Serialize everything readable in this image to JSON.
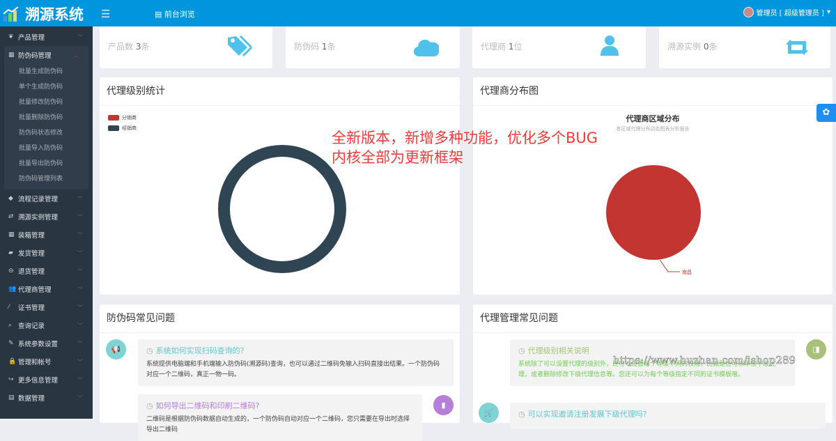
{
  "header": {
    "title": "溯源系统",
    "front_label": "前台浏览",
    "user": "管理员 [ 超级管理员 ]"
  },
  "sidebar": {
    "items": [
      {
        "label": "产品管理",
        "icon": "leaf-icon"
      },
      {
        "label": "防伪码管理",
        "icon": "qrcode-icon",
        "open": true,
        "children": [
          "批量生成防伪码",
          "单个生成防伪码",
          "批量修改防伪码",
          "批量删除防伪码",
          "防伪码状态修改",
          "批量导入防伪码",
          "批量导出防伪码",
          "防伪码管理列表"
        ]
      },
      {
        "label": "流程记录管理",
        "icon": "tags-icon"
      },
      {
        "label": "溯源实例管理",
        "icon": "retweet-icon"
      },
      {
        "label": "装箱管理",
        "icon": "grid-icon"
      },
      {
        "label": "发货管理",
        "icon": "truck-icon"
      },
      {
        "label": "退货管理",
        "icon": "minus-circle-icon"
      },
      {
        "label": "代理商管理",
        "icon": "users-icon"
      },
      {
        "label": "证书管理",
        "icon": "magic-icon"
      },
      {
        "label": "查询记录",
        "icon": "search-icon"
      },
      {
        "label": "系统参数设置",
        "icon": "wrench-icon"
      },
      {
        "label": "管理和帐号",
        "icon": "lock-icon"
      },
      {
        "label": "更多信息管理",
        "icon": "share-icon"
      },
      {
        "label": "数据管理",
        "icon": "database-icon"
      }
    ]
  },
  "stats": [
    {
      "label": "产品数",
      "value": "3",
      "unit": "条"
    },
    {
      "label": "防伪码",
      "value": "1",
      "unit": "条"
    },
    {
      "label": "代理商",
      "value": "1",
      "unit": "位"
    },
    {
      "label": "溯源实例",
      "value": "0",
      "unit": "条"
    }
  ],
  "panels": {
    "level_title": "代理级别统计",
    "dist_title": "代理商分布图",
    "faq1_title": "防伪码常见问题",
    "faq2_title": "代理管理常见问题"
  },
  "chart_data": [
    {
      "type": "pie",
      "title": "代理级别统计",
      "legend": [
        "分销商",
        "经销商"
      ],
      "legend_position": "top-left",
      "series": [
        {
          "name": "分销商",
          "value": 0,
          "color": "#c23531"
        },
        {
          "name": "经销商",
          "value": 1,
          "color": "#2f4554"
        }
      ],
      "donut": true
    },
    {
      "type": "pie",
      "title": "代理商区域分布",
      "subtitle": "各区域代理分布动态图表分析报告",
      "series": [
        {
          "name": "南昌",
          "value": 1,
          "color": "#c23531"
        }
      ]
    }
  ],
  "overlay": {
    "line1": "全新版本，新增多种功能，优化多个BUG",
    "line2": "内核全部为更新框架"
  },
  "faq1": [
    {
      "q": "系统如何实现扫码查询的?",
      "a": "系统提供电脑端和手机端输入防伪码(溯源码)查询，也可以通过二维码免输入扫码直接出结果。一个防伪码对应一个二维码，真正一物一码。"
    },
    {
      "q": "如何导出二维码和印刷二维码?",
      "a": "二维码是根据防伪码数据自动生成的，一个防伪码自动对应一个二维码，您只需要在导出时选择导出二维码"
    }
  ],
  "faq2": [
    {
      "q": "代理级别相关说明",
      "a": "系统除了可以设置代理的级别外，还可以设置每个等级不同的权限，比如是否可以审核下级代理，或者删除修改下级代理信息等。您还可以为每个等级指定不同的证书模板哦。"
    },
    {
      "q": "可以实现邀请注册发展下级代理吗?"
    }
  ],
  "watermark": "https://www.huzhan.com/ishop289"
}
